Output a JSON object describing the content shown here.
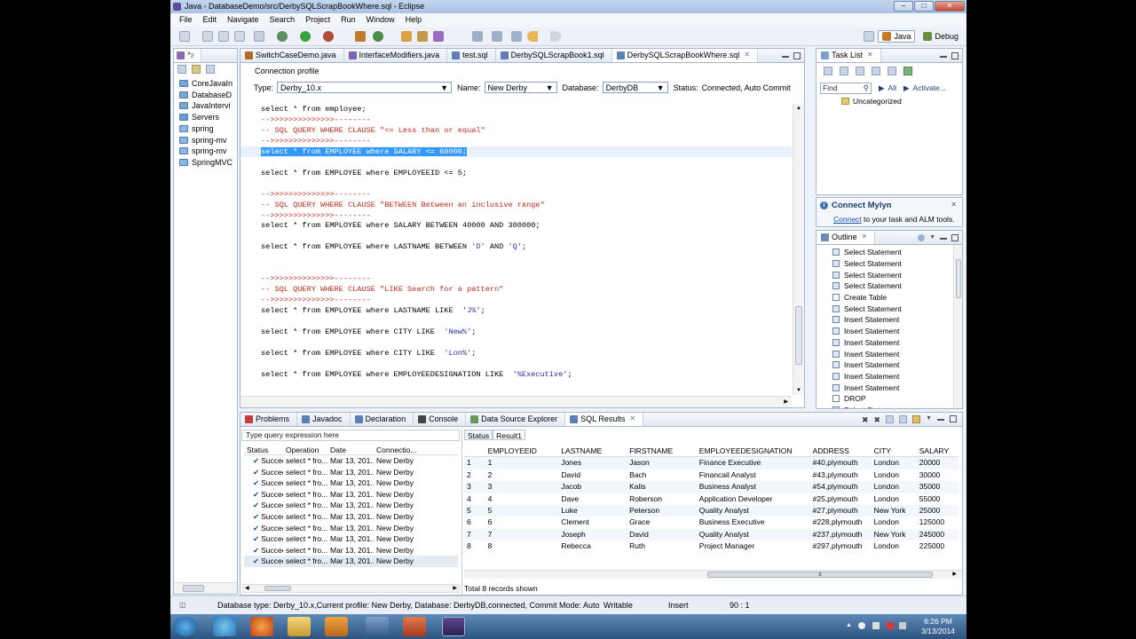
{
  "window": {
    "title": "Java - DatabaseDemo/src/DerbySQLScrapBookWhere.sql - Eclipse"
  },
  "menu": [
    "File",
    "Edit",
    "Navigate",
    "Search",
    "Project",
    "Run",
    "Window",
    "Help"
  ],
  "perspectives": {
    "java": "Java",
    "debug": "Debug"
  },
  "package_explorer": {
    "items": [
      "CoreJavaIn",
      "DatabaseD",
      "JavaIntervi",
      "Servers",
      "spring",
      "spring-mv",
      "spring-mv",
      "SpringMVC"
    ]
  },
  "editor": {
    "tabs": [
      "SwitchCaseDemo.java",
      "InterfaceModifiers.java",
      "test.sql",
      "DerbySQLScrapBook1.sql",
      "DerbySQLScrapBookWhere.sql"
    ],
    "connection_profile": {
      "group_label": "Connection profile",
      "type_label": "Type:",
      "type_value": "Derby_10.x",
      "name_label": "Name:",
      "name_value": "New Derby",
      "database_label": "Database:",
      "database_value": "DerbyDB",
      "status_label": "Status:",
      "status_value": "Connected, Auto Commit"
    },
    "code_lines": [
      {
        "segments": [
          {
            "t": "select * from employee;",
            "c": "kw"
          }
        ]
      },
      {
        "segments": [
          {
            "t": "-->>>>>>>>>>>>>>--------",
            "c": "cmt"
          }
        ]
      },
      {
        "segments": [
          {
            "t": "-- SQL QUERY WHERE CLAUSE \"<= Less than or equal\"",
            "c": "cmt"
          }
        ]
      },
      {
        "segments": [
          {
            "t": "-->>>>>>>>>>>>>>--------",
            "c": "cmt"
          }
        ]
      },
      {
        "segments": [
          {
            "t": "select * from EMPLOYEE where SALARY <= 60000;",
            "c": "selbg"
          }
        ],
        "highlight": true
      },
      {
        "segments": []
      },
      {
        "segments": [
          {
            "t": "select * from EMPLOYEE where EMPLOYEEID <= 5;",
            "c": "kw"
          }
        ]
      },
      {
        "segments": []
      },
      {
        "segments": [
          {
            "t": "-->>>>>>>>>>>>>>--------",
            "c": "cmt"
          }
        ]
      },
      {
        "segments": [
          {
            "t": "-- SQL QUERY WHERE CLAUSE \"BETWEEN Between an inclusive range\"",
            "c": "cmt"
          }
        ]
      },
      {
        "segments": [
          {
            "t": "-->>>>>>>>>>>>>>--------",
            "c": "cmt"
          }
        ]
      },
      {
        "segments": [
          {
            "t": "select * from EMPLOYEE where SALARY BETWEEN 40000 AND 300000;",
            "c": "kw"
          }
        ]
      },
      {
        "segments": []
      },
      {
        "segments": [
          {
            "t": "select * from EMPLOYEE where LASTNAME BETWEEN ",
            "c": "kw"
          },
          {
            "t": "'D'",
            "c": "str"
          },
          {
            "t": " AND ",
            "c": "kw"
          },
          {
            "t": "'Q'",
            "c": "str"
          },
          {
            "t": ";",
            "c": "kw"
          }
        ]
      },
      {
        "segments": []
      },
      {
        "segments": []
      },
      {
        "segments": [
          {
            "t": "-->>>>>>>>>>>>>>--------",
            "c": "cmt"
          }
        ]
      },
      {
        "segments": [
          {
            "t": "-- SQL QUERY WHERE CLAUSE \"LIKE Search for a pattern\"",
            "c": "cmt"
          }
        ]
      },
      {
        "segments": [
          {
            "t": "-->>>>>>>>>>>>>>--------",
            "c": "cmt"
          }
        ]
      },
      {
        "segments": [
          {
            "t": "select * from EMPLOYEE where LASTNAME LIKE  ",
            "c": "kw"
          },
          {
            "t": "'J%'",
            "c": "str"
          },
          {
            "t": ";",
            "c": "kw"
          }
        ]
      },
      {
        "segments": []
      },
      {
        "segments": [
          {
            "t": "select * from EMPLOYEE where CITY LIKE  ",
            "c": "kw"
          },
          {
            "t": "'New%'",
            "c": "str"
          },
          {
            "t": ";",
            "c": "kw"
          }
        ]
      },
      {
        "segments": []
      },
      {
        "segments": [
          {
            "t": "select * from EMPLOYEE where CITY LIKE  ",
            "c": "kw"
          },
          {
            "t": "'Lon%'",
            "c": "str"
          },
          {
            "t": ";",
            "c": "kw"
          }
        ]
      },
      {
        "segments": []
      },
      {
        "segments": [
          {
            "t": "select * from EMPLOYEE where EMPLOYEEDESIGNATION LIKE  ",
            "c": "kw"
          },
          {
            "t": "'%Executive'",
            "c": "str"
          },
          {
            "t": ";",
            "c": "kw"
          }
        ]
      }
    ]
  },
  "task_list": {
    "tab": "Task List",
    "find_placeholder": "Find",
    "all_label": "All",
    "activate_label": "Activate...",
    "category": "Uncategorized"
  },
  "mylyn": {
    "title": "Connect Mylyn",
    "link": "Connect",
    "text": " to your task and ALM tools."
  },
  "outline": {
    "tab": "Outline",
    "items": [
      "Select Statement",
      "Select Statement",
      "Select Statement",
      "Select Statement",
      "Create Table",
      "Select Statement",
      "Insert Statement",
      "Insert Statement",
      "Insert Statement",
      "Insert Statement",
      "Insert Statement",
      "Insert Statement",
      "Insert Statement",
      "DROP",
      "Select Statement"
    ]
  },
  "bottom_tabs": [
    "Problems",
    "Javadoc",
    "Declaration",
    "Console",
    "Data Source Explorer",
    "SQL Results"
  ],
  "sql_history": {
    "placeholder": "Type query expression here",
    "headers": [
      "Status",
      "Operation",
      "Date",
      "Connectio..."
    ],
    "rows": [
      [
        "Succee",
        "select * fro...",
        "Mar 13, 201...",
        "New Derby"
      ],
      [
        "Succee",
        "select * fro...",
        "Mar 13, 201...",
        "New Derby"
      ],
      [
        "Succee",
        "select * fro...",
        "Mar 13, 201...",
        "New Derby"
      ],
      [
        "Succee",
        "select * fro...",
        "Mar 13, 201...",
        "New Derby"
      ],
      [
        "Succee",
        "select * fro...",
        "Mar 13, 201...",
        "New Derby"
      ],
      [
        "Succee",
        "select * fro...",
        "Mar 13, 201...",
        "New Derby"
      ],
      [
        "Succee",
        "select * fro...",
        "Mar 13, 201...",
        "New Derby"
      ],
      [
        "Succee",
        "select * fro...",
        "Mar 13, 201...",
        "New Derby"
      ],
      [
        "Succee",
        "select * fro...",
        "Mar 13, 201...",
        "New Derby"
      ],
      [
        "Succee",
        "select * fro...",
        "Mar 13, 201...",
        "New Derby"
      ]
    ]
  },
  "result": {
    "tabs": [
      "Status",
      "Result1"
    ],
    "headers": [
      "EMPLOYEEID",
      "LASTNAME",
      "FIRSTNAME",
      "EMPLOYEEDESIGNATION",
      "ADDRESS",
      "CITY",
      "SALARY"
    ],
    "rows": [
      [
        "1",
        "1",
        "Jones",
        "Jason",
        "Finance Executive",
        "#40,plymouth",
        "London",
        "20000"
      ],
      [
        "2",
        "2",
        "David",
        "Bach",
        "Financail Analyst",
        "#43,plymouth",
        "London",
        "30000"
      ],
      [
        "3",
        "3",
        "Jacob",
        "Kalis",
        "Business Analyst",
        "#54,plymouth",
        "London",
        "35000"
      ],
      [
        "4",
        "4",
        "Dave",
        "Roberson",
        "Application Developer",
        "#25,plymouth",
        "London",
        "55000"
      ],
      [
        "5",
        "5",
        "Luke",
        "Peterson",
        "Quality Analyst",
        "#27,plymouth",
        "New York",
        "25000"
      ],
      [
        "6",
        "6",
        "Clement",
        "Grace",
        "Business Executive",
        "#228,plymouth",
        "London",
        "125000"
      ],
      [
        "7",
        "7",
        "Joseph",
        "David",
        "Quality Analyst",
        "#237,plymouth",
        "New York",
        "245000"
      ],
      [
        "8",
        "8",
        "Rebecca",
        "Ruth",
        "Project Manager",
        "#297,plymouth",
        "London",
        "225000"
      ]
    ],
    "footer": "Total 8 records shown"
  },
  "statusbar": {
    "message": "Database type: Derby_10.x,Current profile: New Derby, Database: DerbyDB,connected, Commit Mode: Auto",
    "writable": "Writable",
    "insert": "Insert",
    "position": "90 : 1"
  },
  "clock": {
    "time": "6:26 PM",
    "date": "3/13/2014"
  }
}
